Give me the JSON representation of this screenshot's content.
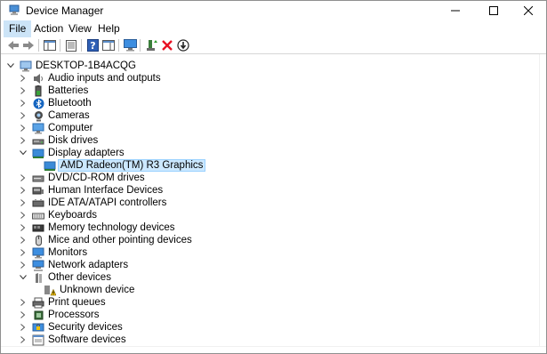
{
  "window": {
    "title": "Device Manager"
  },
  "menu": {
    "file": "File",
    "action": "Action",
    "view": "View",
    "help": "Help"
  },
  "tree": {
    "root": "DESKTOP-1B4ACQG",
    "categories": [
      {
        "label": "Audio inputs and outputs",
        "icon": "speaker-icon",
        "expanded": false
      },
      {
        "label": "Batteries",
        "icon": "battery-icon",
        "expanded": false
      },
      {
        "label": "Bluetooth",
        "icon": "bluetooth-icon",
        "expanded": false
      },
      {
        "label": "Cameras",
        "icon": "camera-icon",
        "expanded": false
      },
      {
        "label": "Computer",
        "icon": "computer-icon",
        "expanded": false
      },
      {
        "label": "Disk drives",
        "icon": "disk-drive-icon",
        "expanded": false
      },
      {
        "label": "Display adapters",
        "icon": "display-adapter-icon",
        "expanded": true,
        "children": [
          {
            "label": "AMD Radeon(TM) R3 Graphics",
            "icon": "display-adapter-icon",
            "selected": true
          }
        ]
      },
      {
        "label": "DVD/CD-ROM drives",
        "icon": "dvd-drive-icon",
        "expanded": false
      },
      {
        "label": "Human Interface Devices",
        "icon": "hid-icon",
        "expanded": false
      },
      {
        "label": "IDE ATA/ATAPI controllers",
        "icon": "ide-controller-icon",
        "expanded": false
      },
      {
        "label": "Keyboards",
        "icon": "keyboard-icon",
        "expanded": false
      },
      {
        "label": "Memory technology devices",
        "icon": "memory-icon",
        "expanded": false
      },
      {
        "label": "Mice and other pointing devices",
        "icon": "mouse-icon",
        "expanded": false
      },
      {
        "label": "Monitors",
        "icon": "monitor-icon",
        "expanded": false
      },
      {
        "label": "Network adapters",
        "icon": "network-adapter-icon",
        "expanded": false
      },
      {
        "label": "Other devices",
        "icon": "other-devices-icon",
        "expanded": true,
        "children": [
          {
            "label": "Unknown device",
            "icon": "unknown-device-warning-icon",
            "selected": false
          }
        ]
      },
      {
        "label": "Print queues",
        "icon": "printer-icon",
        "expanded": false
      },
      {
        "label": "Processors",
        "icon": "processor-icon",
        "expanded": false
      },
      {
        "label": "Security devices",
        "icon": "security-device-icon",
        "expanded": false
      },
      {
        "label": "Software devices",
        "icon": "software-device-icon",
        "expanded": false
      }
    ]
  },
  "colors": {
    "selection_bg": "#cce8ff",
    "menu_active_bg": "#cce4f7",
    "remove_red": "#e81123"
  }
}
